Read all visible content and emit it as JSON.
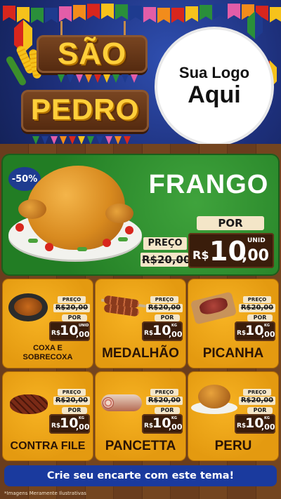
{
  "hero": {
    "title_line1": "SÃO",
    "title_line2": "PEDRO",
    "logo_line1": "Sua Logo",
    "logo_line2": "Aqui",
    "flag_colors": [
      "#d8261d",
      "#f6c21b",
      "#2a8f3a",
      "#1e3b8f",
      "#e35da8",
      "#f28c1b"
    ]
  },
  "featured": {
    "discount": "-50%",
    "name": "FRANGO",
    "preco_label": "PREÇO",
    "old_price": "R$20,00",
    "por_label": "POR",
    "currency": "R$",
    "price_int": "10",
    "price_dec": ",00",
    "unit": "UNID"
  },
  "products": [
    {
      "name_line1": "COXA E",
      "name_line2": "SOBRECOXA",
      "preco_label": "PREÇO",
      "old_price": "R$20,00",
      "por_label": "POR",
      "currency": "R$",
      "price_int": "10",
      "price_dec": ",00",
      "unit": "UNID",
      "image": "chicken-thigh-pan"
    },
    {
      "name_line1": "MEDALHÃO",
      "name_line2": "",
      "preco_label": "PREÇO",
      "old_price": "R$20,00",
      "por_label": "POR",
      "currency": "R$",
      "price_int": "10",
      "price_dec": ",00",
      "unit": "KG",
      "image": "skewers"
    },
    {
      "name_line1": "PICANHA",
      "name_line2": "",
      "preco_label": "PREÇO",
      "old_price": "R$20,00",
      "por_label": "POR",
      "currency": "R$",
      "price_int": "10",
      "price_dec": ",00",
      "unit": "KG",
      "image": "picanha-board"
    },
    {
      "name_line1": "CONTRA FILE",
      "name_line2": "",
      "preco_label": "PREÇO",
      "old_price": "R$20,00",
      "por_label": "POR",
      "currency": "R$",
      "price_int": "10",
      "price_dec": ",00",
      "unit": "KG",
      "image": "steak"
    },
    {
      "name_line1": "PANCETTA",
      "name_line2": "",
      "preco_label": "PREÇO",
      "old_price": "R$20,00",
      "por_label": "POR",
      "currency": "R$",
      "price_int": "10",
      "price_dec": ",00",
      "unit": "KG",
      "image": "pancetta-roll"
    },
    {
      "name_line1": "PERU",
      "name_line2": "",
      "preco_label": "PREÇO",
      "old_price": "R$20,00",
      "por_label": "POR",
      "currency": "R$",
      "price_int": "10",
      "price_dec": ",00",
      "unit": "KG",
      "image": "roast-turkey"
    }
  ],
  "footer": {
    "cta": "Crie seu encarte com este tema!",
    "disclaimer": "*Imagens Meramente Ilustrativas"
  }
}
